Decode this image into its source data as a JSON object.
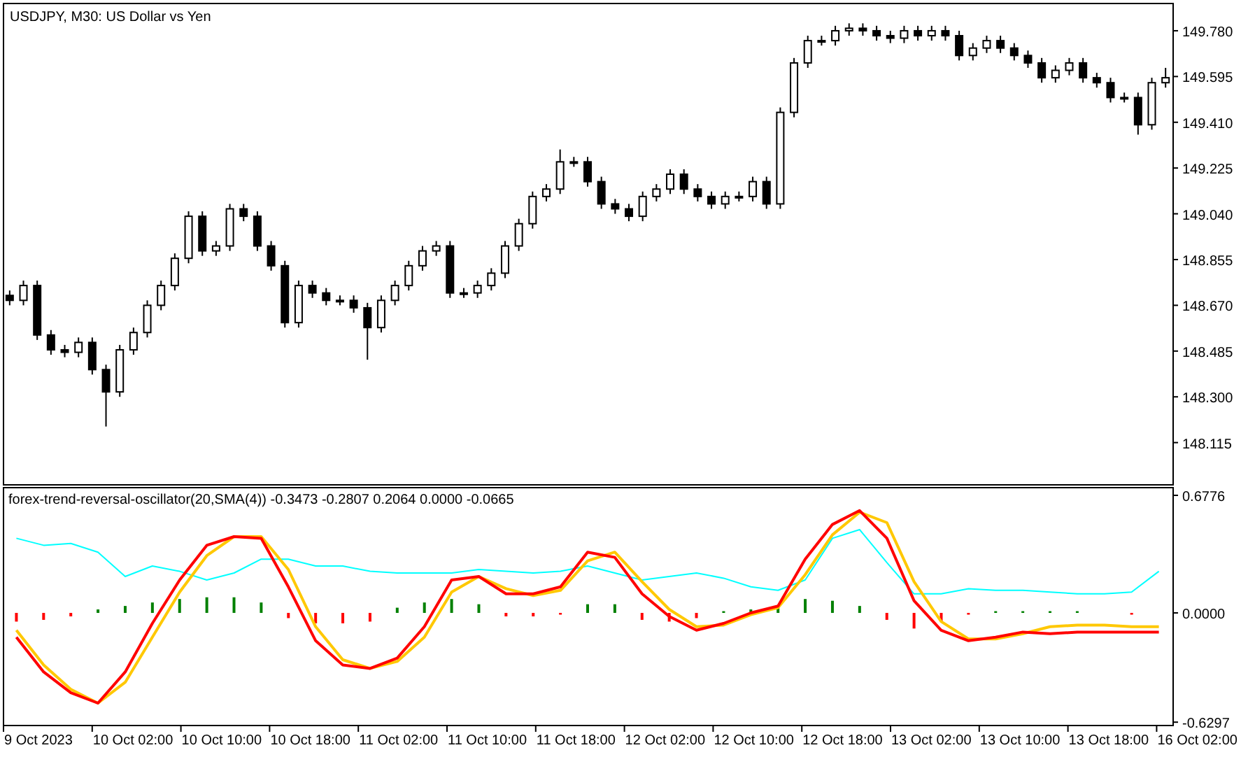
{
  "price_chart": {
    "chart_data": {
      "type": "candlestick",
      "title": "USDJPY, M30:  US Dollar vs Yen",
      "ylim": [
        147.947,
        149.893
      ],
      "categories": [
        null,
        null,
        null,
        null,
        null,
        null,
        null,
        null,
        null,
        null,
        null,
        null,
        null,
        null,
        null,
        null,
        null,
        null,
        null,
        null,
        null,
        null,
        null,
        null,
        null,
        null,
        null,
        null,
        null,
        null,
        null,
        null,
        null,
        null,
        null,
        null,
        null,
        null,
        null,
        null,
        null,
        null,
        null,
        null,
        null,
        null,
        null,
        null,
        null,
        null,
        null,
        null,
        null,
        null,
        null,
        null,
        null,
        null,
        null,
        null,
        null,
        null,
        null,
        null,
        null,
        null,
        null,
        null,
        null,
        null,
        null,
        null,
        null,
        null,
        null,
        null,
        null,
        null,
        null,
        null,
        null,
        null,
        null,
        null,
        null
      ],
      "yticks": [
        {
          "value": 149.78,
          "label": "149.780"
        },
        {
          "value": 149.595,
          "label": "149.595"
        },
        {
          "value": 149.41,
          "label": "149.410"
        },
        {
          "value": 149.225,
          "label": "149.225"
        },
        {
          "value": 149.04,
          "label": "149.040"
        },
        {
          "value": 148.855,
          "label": "148.855"
        },
        {
          "value": 148.67,
          "label": "148.670"
        },
        {
          "value": 148.485,
          "label": "148.485"
        },
        {
          "value": 148.3,
          "label": "148.300"
        },
        {
          "value": 148.115,
          "label": "148.115"
        }
      ],
      "ohlc": [
        [
          148.71,
          148.73,
          148.67,
          148.69
        ],
        [
          148.69,
          148.77,
          148.67,
          148.75
        ],
        [
          148.75,
          148.77,
          148.53,
          148.55
        ],
        [
          148.55,
          148.57,
          148.47,
          148.49
        ],
        [
          148.49,
          148.51,
          148.46,
          148.48
        ],
        [
          148.48,
          148.54,
          148.46,
          148.52
        ],
        [
          148.52,
          148.54,
          148.39,
          148.41
        ],
        [
          148.41,
          148.43,
          148.18,
          148.32
        ],
        [
          148.32,
          148.51,
          148.3,
          148.49
        ],
        [
          148.49,
          148.58,
          148.47,
          148.56
        ],
        [
          148.56,
          148.69,
          148.54,
          148.67
        ],
        [
          148.67,
          148.77,
          148.65,
          148.75
        ],
        [
          148.75,
          148.88,
          148.73,
          148.86
        ],
        [
          148.86,
          149.05,
          148.84,
          149.03
        ],
        [
          149.03,
          149.05,
          148.87,
          148.89
        ],
        [
          148.89,
          148.93,
          148.87,
          148.91
        ],
        [
          148.91,
          149.08,
          148.89,
          149.06
        ],
        [
          149.06,
          149.08,
          149.01,
          149.03
        ],
        [
          149.03,
          149.05,
          148.89,
          148.91
        ],
        [
          148.91,
          148.93,
          148.81,
          148.83
        ],
        [
          148.83,
          148.85,
          148.58,
          148.6
        ],
        [
          148.6,
          148.77,
          148.58,
          148.75
        ],
        [
          148.75,
          148.77,
          148.7,
          148.72
        ],
        [
          148.72,
          148.74,
          148.67,
          148.69
        ],
        [
          148.69,
          148.71,
          148.67,
          148.69
        ],
        [
          148.69,
          148.71,
          148.64,
          148.66
        ],
        [
          148.66,
          148.68,
          148.45,
          148.58
        ],
        [
          148.58,
          148.71,
          148.56,
          148.69
        ],
        [
          148.69,
          148.77,
          148.67,
          148.75
        ],
        [
          148.75,
          148.85,
          148.73,
          148.83
        ],
        [
          148.83,
          148.91,
          148.81,
          148.89
        ],
        [
          148.89,
          148.93,
          148.87,
          148.91
        ],
        [
          148.91,
          148.93,
          148.7,
          148.72
        ],
        [
          148.72,
          148.74,
          148.7,
          148.72
        ],
        [
          148.72,
          148.77,
          148.7,
          148.75
        ],
        [
          148.75,
          148.82,
          148.73,
          148.8
        ],
        [
          148.8,
          148.93,
          148.78,
          148.91
        ],
        [
          148.91,
          149.02,
          148.89,
          149.0
        ],
        [
          149.0,
          149.13,
          148.98,
          149.11
        ],
        [
          149.11,
          149.16,
          149.09,
          149.14
        ],
        [
          149.14,
          149.3,
          149.12,
          149.25
        ],
        [
          149.25,
          149.27,
          149.23,
          149.25
        ],
        [
          149.25,
          149.27,
          149.15,
          149.17
        ],
        [
          149.17,
          149.19,
          149.06,
          149.08
        ],
        [
          149.08,
          149.1,
          149.04,
          149.06
        ],
        [
          149.06,
          149.08,
          149.01,
          149.03
        ],
        [
          149.03,
          149.13,
          149.01,
          149.11
        ],
        [
          149.11,
          149.16,
          149.09,
          149.14
        ],
        [
          149.14,
          149.22,
          149.12,
          149.2
        ],
        [
          149.2,
          149.22,
          149.12,
          149.14
        ],
        [
          149.14,
          149.16,
          149.09,
          149.11
        ],
        [
          149.11,
          149.13,
          149.06,
          149.08
        ],
        [
          149.08,
          149.13,
          149.06,
          149.11
        ],
        [
          149.11,
          149.13,
          149.09,
          149.11
        ],
        [
          149.11,
          149.19,
          149.09,
          149.17
        ],
        [
          149.17,
          149.19,
          149.06,
          149.08
        ],
        [
          149.08,
          149.47,
          149.06,
          149.45
        ],
        [
          149.45,
          149.67,
          149.43,
          149.65
        ],
        [
          149.65,
          149.76,
          149.63,
          149.74
        ],
        [
          149.74,
          149.76,
          149.72,
          149.74
        ],
        [
          149.74,
          149.8,
          149.72,
          149.78
        ],
        [
          149.78,
          149.81,
          149.76,
          149.79
        ],
        [
          149.79,
          149.81,
          149.76,
          149.78
        ],
        [
          149.78,
          149.8,
          149.74,
          149.76
        ],
        [
          149.76,
          149.78,
          149.73,
          149.75
        ],
        [
          149.75,
          149.8,
          149.73,
          149.78
        ],
        [
          149.78,
          149.8,
          149.74,
          149.76
        ],
        [
          149.76,
          149.8,
          149.74,
          149.78
        ],
        [
          149.78,
          149.8,
          149.74,
          149.76
        ],
        [
          149.76,
          149.78,
          149.66,
          149.68
        ],
        [
          149.68,
          149.73,
          149.66,
          149.71
        ],
        [
          149.71,
          149.76,
          149.69,
          149.74
        ],
        [
          149.74,
          149.76,
          149.69,
          149.71
        ],
        [
          149.71,
          149.73,
          149.66,
          149.68
        ],
        [
          149.68,
          149.7,
          149.63,
          149.65
        ],
        [
          149.65,
          149.67,
          149.57,
          149.59
        ],
        [
          149.59,
          149.64,
          149.57,
          149.62
        ],
        [
          149.62,
          149.67,
          149.6,
          149.65
        ],
        [
          149.65,
          149.67,
          149.57,
          149.59
        ],
        [
          149.59,
          149.61,
          149.55,
          149.57
        ],
        [
          149.57,
          149.59,
          149.49,
          149.51
        ],
        [
          149.51,
          149.53,
          149.49,
          149.51
        ],
        [
          149.51,
          149.53,
          149.36,
          149.4
        ],
        [
          149.4,
          149.59,
          149.38,
          149.57
        ],
        [
          149.57,
          149.63,
          149.55,
          149.59
        ]
      ]
    }
  },
  "oscillator": {
    "label": "forex-trend-reversal-oscillator(20,SMA(4)) -0.3473 -0.2807 0.2064 0.0000 -0.0665",
    "chart_data": {
      "type": "line",
      "ylim": [
        -0.645,
        0.726
      ],
      "stacked": true,
      "categories": [
        null,
        null,
        null,
        null,
        null,
        null,
        null,
        null,
        null,
        null,
        null,
        null,
        null,
        null,
        null,
        null,
        null,
        null,
        null,
        null,
        null,
        null,
        null,
        null,
        null,
        null,
        null,
        null,
        null,
        null,
        null,
        null,
        null,
        null,
        null,
        null,
        null,
        null,
        null,
        null,
        null,
        null,
        null
      ],
      "yticks": [
        {
          "value": 0.6776,
          "label": "0.6776"
        },
        {
          "value": 0,
          "label": "0.0000"
        },
        {
          "value": -0.6297,
          "label": "-0.6297"
        }
      ],
      "series": [
        {
          "type": "bar",
          "color": "#008000",
          "values": [
            null,
            null,
            null,
            0.02,
            0.04,
            0.06,
            0.08,
            0.09,
            0.09,
            0.06,
            null,
            null,
            null,
            null,
            0.03,
            0.06,
            0.08,
            0.05,
            null,
            null,
            null,
            0.05,
            0.05,
            null,
            null,
            null,
            0.01,
            0.02,
            0.04,
            0.08,
            0.07,
            0.04,
            null,
            null,
            null,
            null,
            0.01,
            0.01,
            0.01,
            0.01,
            null,
            null,
            null
          ]
        },
        {
          "type": "bar",
          "color": "#ff0000",
          "values": [
            -0.05,
            -0.04,
            -0.02,
            null,
            null,
            null,
            null,
            null,
            null,
            null,
            -0.03,
            -0.06,
            -0.06,
            -0.05,
            null,
            null,
            null,
            null,
            -0.02,
            -0.02,
            -0.01,
            null,
            null,
            -0.04,
            -0.05,
            -0.03,
            null,
            null,
            null,
            null,
            null,
            null,
            -0.04,
            -0.09,
            -0.05,
            -0.01,
            null,
            null,
            null,
            null,
            null,
            -0.01,
            null
          ]
        },
        {
          "type": "line",
          "color": "#00ffff",
          "values": [
            0.43,
            0.39,
            0.4,
            0.35,
            0.21,
            0.27,
            0.24,
            0.19,
            0.23,
            0.31,
            0.31,
            0.27,
            0.27,
            0.24,
            0.23,
            0.23,
            0.23,
            0.25,
            0.24,
            0.23,
            0.24,
            0.27,
            0.23,
            0.19,
            0.21,
            0.23,
            0.2,
            0.15,
            0.13,
            0.19,
            0.43,
            0.48,
            0.29,
            0.11,
            0.11,
            0.14,
            0.13,
            0.13,
            0.12,
            0.11,
            0.11,
            0.12,
            0.24
          ]
        },
        {
          "type": "line",
          "color": "#ffc800",
          "values": [
            -0.1,
            -0.3,
            -0.44,
            -0.52,
            -0.4,
            -0.14,
            0.12,
            0.33,
            0.44,
            0.44,
            0.25,
            -0.08,
            -0.27,
            -0.32,
            -0.28,
            -0.14,
            0.12,
            0.21,
            0.14,
            0.1,
            0.13,
            0.3,
            0.35,
            0.18,
            0.02,
            -0.08,
            -0.07,
            -0.01,
            0.03,
            0.22,
            0.45,
            0.58,
            0.52,
            0.18,
            -0.05,
            -0.15,
            -0.15,
            -0.12,
            -0.08,
            -0.07,
            -0.07,
            -0.08,
            -0.08
          ]
        },
        {
          "type": "line",
          "color": "#ff0000",
          "values": [
            -0.14,
            -0.34,
            -0.46,
            -0.52,
            -0.34,
            -0.06,
            0.19,
            0.39,
            0.44,
            0.43,
            0.15,
            -0.16,
            -0.3,
            -0.32,
            -0.26,
            -0.08,
            0.19,
            0.21,
            0.11,
            0.11,
            0.15,
            0.35,
            0.32,
            0.11,
            -0.02,
            -0.1,
            -0.06,
            0,
            0.04,
            0.31,
            0.51,
            0.59,
            0.43,
            0.07,
            -0.1,
            -0.16,
            -0.14,
            -0.11,
            -0.12,
            -0.11,
            -0.11,
            -0.11,
            -0.11
          ]
        }
      ]
    }
  },
  "time_axis": [
    "9 Oct 2023",
    "10 Oct 02:00",
    "10 Oct 10:00",
    "10 Oct 18:00",
    "11 Oct 02:00",
    "11 Oct 10:00",
    "11 Oct 18:00",
    "12 Oct 02:00",
    "12 Oct 10:00",
    "12 Oct 18:00",
    "13 Oct 02:00",
    "13 Oct 10:00",
    "13 Oct 18:00",
    "16 Oct 02:00"
  ]
}
